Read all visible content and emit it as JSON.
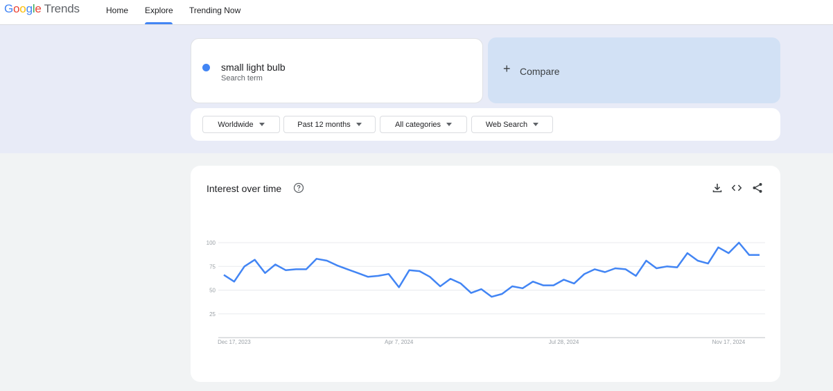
{
  "brand": {
    "google": "Google",
    "product": "Trends"
  },
  "nav": {
    "home": "Home",
    "explore": "Explore",
    "trending": "Trending Now"
  },
  "search_term": {
    "value": "small light bulb",
    "sublabel": "Search term",
    "color": "#4285f4"
  },
  "compare": {
    "plus": "+",
    "label": "Compare"
  },
  "filters": {
    "region": "Worldwide",
    "period": "Past 12 months",
    "category": "All categories",
    "source": "Web Search"
  },
  "card": {
    "title": "Interest over time",
    "icons": [
      "help-icon",
      "download-icon",
      "embed-icon",
      "share-icon"
    ]
  },
  "chart_data": {
    "type": "line",
    "title": "Interest over time",
    "xlabel": "",
    "ylabel": "",
    "ylim": [
      0,
      100
    ],
    "yticks": [
      25,
      50,
      75,
      100
    ],
    "xtick_labels": [
      "Dec 17, 2023",
      "Apr 7, 2024",
      "Jul 28, 2024",
      "Nov 17, 2024"
    ],
    "xtick_indices": [
      1,
      17,
      33,
      49
    ],
    "grid": true,
    "series": [
      {
        "color": "#4285f4",
        "values": [
          66,
          59,
          75,
          82,
          68,
          77,
          71,
          72,
          72,
          83,
          81,
          76,
          72,
          68,
          64,
          65,
          67,
          53,
          71,
          70,
          64,
          54,
          62,
          57,
          47,
          51,
          43,
          46,
          54,
          52,
          59,
          55,
          55,
          61,
          57,
          67,
          72,
          69,
          73,
          72,
          65,
          81,
          73,
          75,
          74,
          89,
          81,
          78,
          95,
          89,
          100,
          87,
          87
        ]
      }
    ]
  }
}
